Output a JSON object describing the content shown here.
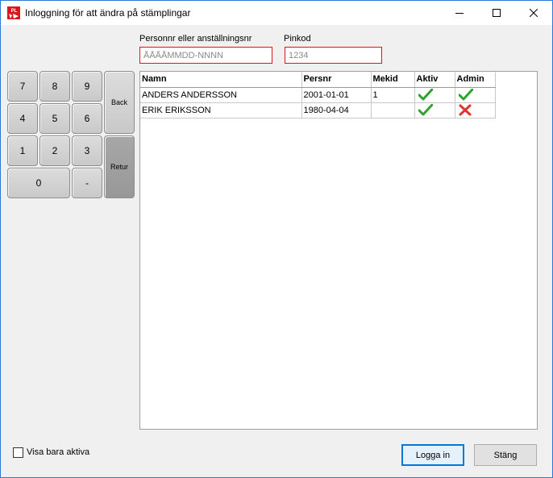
{
  "window": {
    "title": "Inloggning för att ändra på stämplingar",
    "icon_text": "PL"
  },
  "form": {
    "personnr_label": "Personnr eller anställningsnr",
    "personnr_placeholder": "ÅÅÅÅMMDD-NNNN",
    "pinkod_label": "Pinkod",
    "pinkod_placeholder": "1234"
  },
  "keypad": {
    "k7": "7",
    "k8": "8",
    "k9": "9",
    "k4": "4",
    "k5": "5",
    "k6": "6",
    "k1": "1",
    "k2": "2",
    "k3": "3",
    "k0": "0",
    "dash": "-",
    "back": "Back",
    "retur": "Retur"
  },
  "table": {
    "columns": [
      "Namn",
      "Persnr",
      "Mekid",
      "Aktiv",
      "Admin"
    ],
    "rows": [
      {
        "namn": "ANDERS ANDERSSON",
        "persnr": "2001-01-01",
        "mekid": "1",
        "aktiv": "check-icon",
        "admin": "check-icon"
      },
      {
        "namn": "ERIK ERIKSSON",
        "persnr": "1980-04-04",
        "mekid": "",
        "aktiv": "check-icon",
        "admin": "cross-icon"
      }
    ]
  },
  "footer": {
    "show_active_label": "Visa bara aktiva",
    "login_button": "Logga in",
    "close_button": "Stäng"
  },
  "colors": {
    "error_border": "#d9181b",
    "check_green": "#2aa52a",
    "cross_red": "#e0332a",
    "focus_blue": "#0078d7"
  }
}
